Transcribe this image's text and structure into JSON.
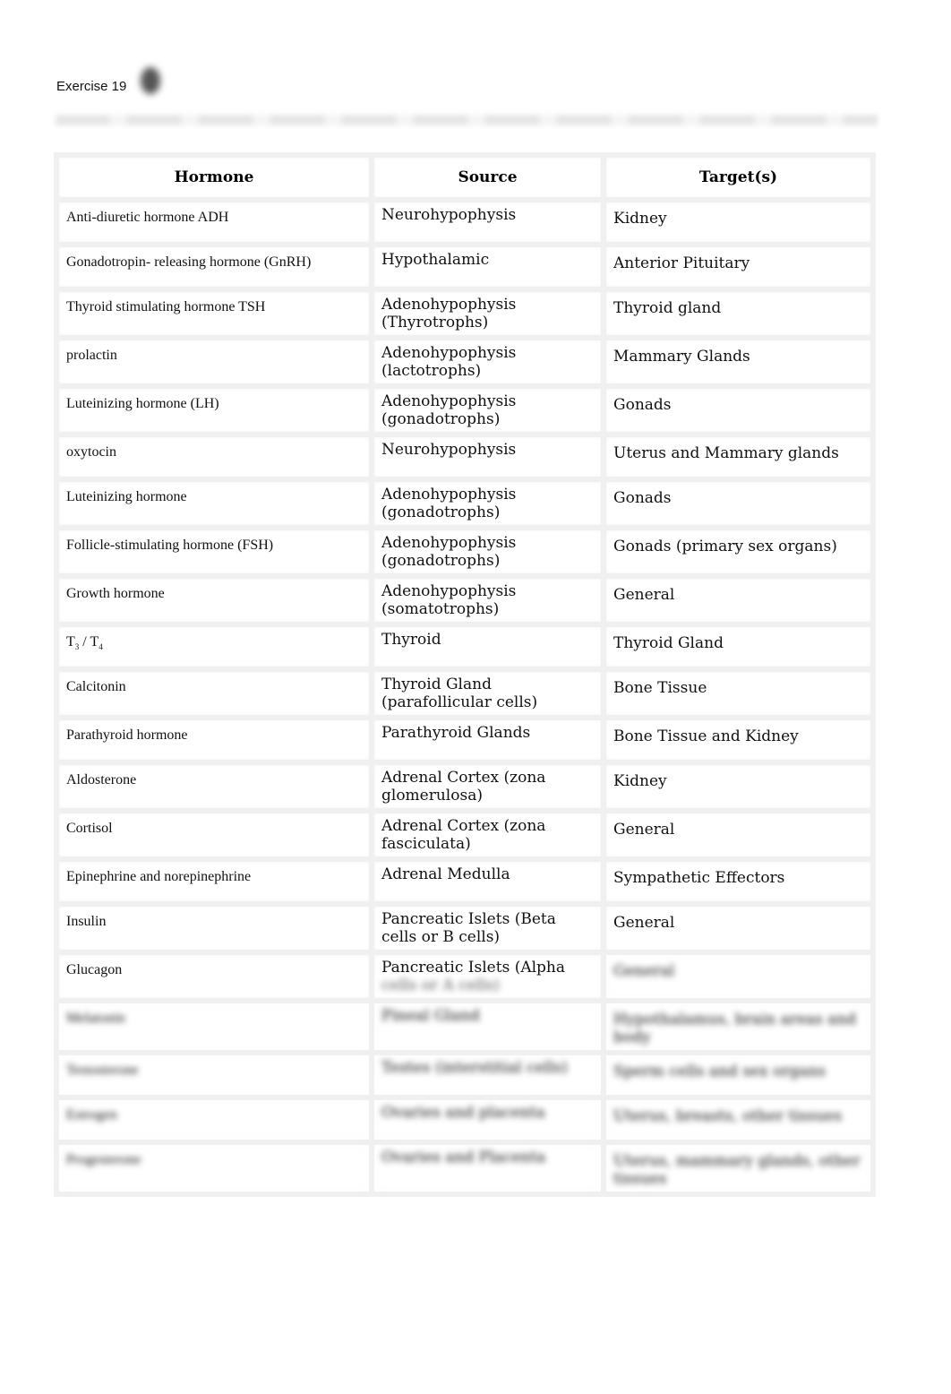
{
  "document": {
    "title": "Exercise 19"
  },
  "table": {
    "headers": [
      "Hormone",
      "Source",
      "Target(s)"
    ],
    "rows": [
      {
        "hormone": "Anti-diuretic hormone ADH",
        "source": "Neurohypophysis",
        "target": "Kidney"
      },
      {
        "hormone": "Gonadotropin-  releasing hormone (GnRH)",
        "source": "Hypothalamic",
        "target": "Anterior Pituitary"
      },
      {
        "hormone": "Thyroid stimulating hormone TSH",
        "source": "Adenohypophysis (Thyrotrophs)",
        "target": "Thyroid gland"
      },
      {
        "hormone": "prolactin",
        "source": "Adenohypophysis (lactotrophs)",
        "target": "Mammary Glands"
      },
      {
        "hormone": "Luteinizing hormone (LH)",
        "source": "Adenohypophysis (gonadotrophs)",
        "target": "Gonads"
      },
      {
        "hormone": "oxytocin",
        "source": "Neurohypophysis",
        "target": "Uterus and Mammary glands"
      },
      {
        "hormone": "Luteinizing  hormone",
        "source": "Adenohypophysis (gonadotrophs)",
        "target": "Gonads"
      },
      {
        "hormone": "Follicle-stimulating hormone (FSH)",
        "source": "Adenohypophysis (gonadotrophs)",
        "target": "Gonads (primary sex organs)"
      },
      {
        "hormone": "Growth hormone",
        "source": "Adenohypophysis (somatotrophs)",
        "target": "General"
      },
      {
        "hormone_t": "T",
        "hormone_sub1": "3",
        "hormone_mid": " / T",
        "hormone_sub2": "4",
        "source": "Thyroid",
        "target": "Thyroid Gland"
      },
      {
        "hormone": "Calcitonin",
        "source": "Thyroid Gland (parafollicular cells)",
        "target": "Bone Tissue"
      },
      {
        "hormone": "Parathyroid  hormone",
        "source": "Parathyroid Glands",
        "target": "Bone Tissue and Kidney"
      },
      {
        "hormone": "Aldosterone",
        "source": "Adrenal Cortex (zona glomerulosa)",
        "target": "Kidney"
      },
      {
        "hormone": "Cortisol",
        "source": "Adrenal Cortex (zona fasciculata)",
        "target": "General"
      },
      {
        "hormone": "Epinephrine  and  norepinephrine",
        "source": "Adrenal Medulla",
        "target": "Sympathetic Effectors"
      },
      {
        "hormone": "Insulin",
        "source": "Pancreatic Islets (Beta cells or B cells)",
        "target": "General"
      },
      {
        "hormone": "Glucagon",
        "source": "Pancreatic Islets (Alpha",
        "source_obscured": "cells or A cells)",
        "target_obscured": "General"
      },
      {
        "hormone_obscured": "Melatonin",
        "source_obscured": "Pineal Gland",
        "target_obscured": "Hypothalamus, brain areas and body"
      },
      {
        "hormone_obscured": "Testosterone",
        "source_obscured": "Testes (interstitial cells)",
        "target_obscured": "Sperm cells and sex organs"
      },
      {
        "hormone_obscured": "Estrogen",
        "source_obscured": "Ovaries and placenta",
        "target_obscured": "Uterus, breasts, other tissues"
      },
      {
        "hormone_obscured": "Progesterone",
        "source_obscured": "Ovaries and Placenta",
        "target_obscured": "Uterus, mammary glands, other tissues"
      }
    ]
  }
}
